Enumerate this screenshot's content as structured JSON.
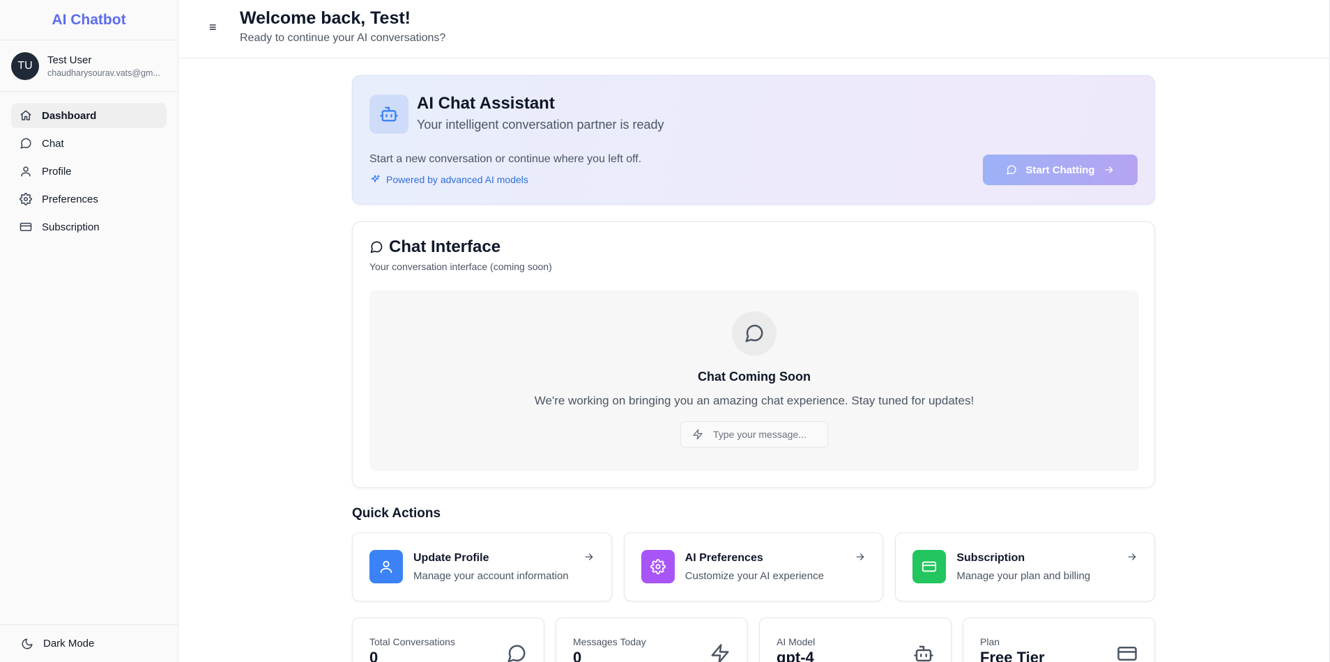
{
  "sidebar": {
    "brand": "AI Chatbot",
    "user": {
      "initials": "TU",
      "name": "Test User",
      "email": "chaudharysourav.vats@gm..."
    },
    "nav": [
      {
        "label": "Dashboard",
        "icon": "home-icon",
        "active": true
      },
      {
        "label": "Chat",
        "icon": "message-circle-icon",
        "active": false
      },
      {
        "label": "Profile",
        "icon": "user-icon",
        "active": false
      },
      {
        "label": "Preferences",
        "icon": "gear-icon",
        "active": false
      },
      {
        "label": "Subscription",
        "icon": "credit-card-icon",
        "active": false
      }
    ],
    "dark_mode_label": "Dark Mode"
  },
  "header": {
    "menu_icon": "menu-icon",
    "title": "Welcome back, Test!",
    "subtitle": "Ready to continue your AI conversations?"
  },
  "hero": {
    "icon": "bot-icon",
    "title": "AI Chat Assistant",
    "subtitle": "Your intelligent conversation partner is ready",
    "description": "Start a new conversation or continue where you left off.",
    "powered_by": "Powered by advanced AI models",
    "button_label": "Start Chatting",
    "accent": "#3b82f6"
  },
  "chat": {
    "title": "Chat Interface",
    "description": "Your conversation interface (coming soon)",
    "coming_title": "Chat Coming Soon",
    "coming_desc": "We're working on bringing you an amazing chat experience. Stay tuned for updates!",
    "input_placeholder": "Type your message..."
  },
  "quick_actions": {
    "title": "Quick Actions",
    "items": [
      {
        "name": "Update Profile",
        "desc": "Manage your account information",
        "icon": "user-icon",
        "color": "#3b82f6"
      },
      {
        "name": "AI Preferences",
        "desc": "Customize your AI experience",
        "icon": "gear-icon",
        "color": "#a855f7"
      },
      {
        "name": "Subscription",
        "desc": "Manage your plan and billing",
        "icon": "credit-card-icon",
        "color": "#22c55e"
      }
    ]
  },
  "stats": [
    {
      "label": "Total Conversations",
      "value": "0",
      "icon": "message-circle-icon"
    },
    {
      "label": "Messages Today",
      "value": "0",
      "icon": "zap-icon"
    },
    {
      "label": "AI Model",
      "value": "gpt-4",
      "icon": "bot-icon"
    },
    {
      "label": "Plan",
      "value": "Free Tier",
      "icon": "credit-card-icon"
    }
  ]
}
